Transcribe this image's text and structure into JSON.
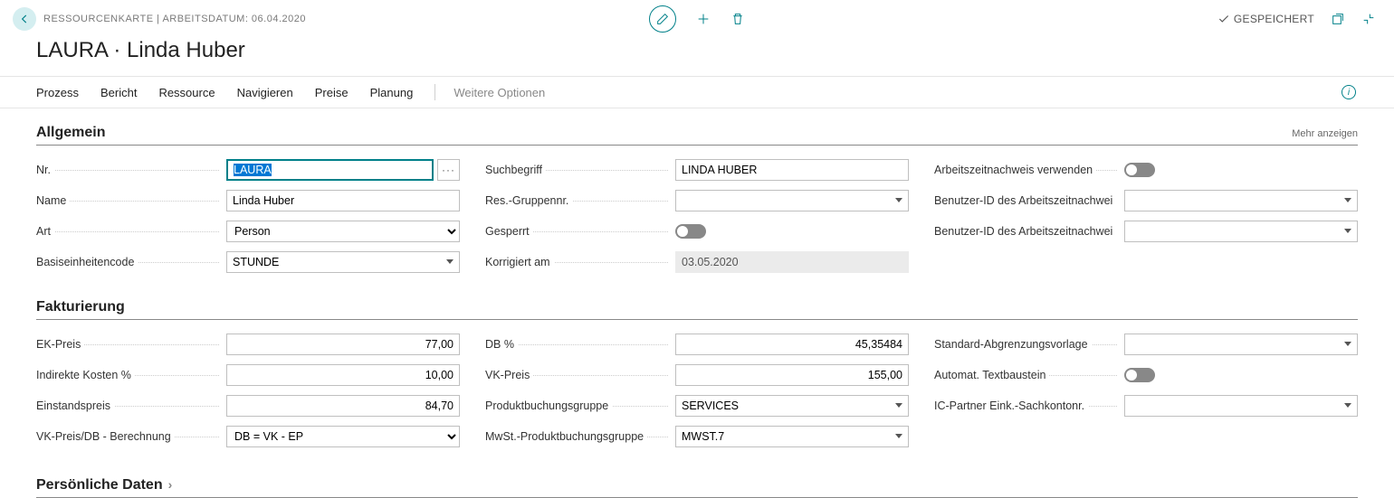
{
  "header": {
    "breadcrumb": "RESSOURCENKARTE | ARBEITSDATUM: 06.04.2020",
    "saved": "GESPEICHERT"
  },
  "title": "LAURA · Linda Huber",
  "menu": {
    "items": [
      "Prozess",
      "Bericht",
      "Ressource",
      "Navigieren",
      "Preise",
      "Planung"
    ],
    "more": "Weitere Optionen"
  },
  "sections": {
    "allgemein": {
      "title": "Allgemein",
      "show_more": "Mehr anzeigen",
      "fields": {
        "nr_label": "Nr.",
        "nr_value": "LAURA",
        "name_label": "Name",
        "name_value": "Linda Huber",
        "art_label": "Art",
        "art_value": "Person",
        "basis_label": "Basiseinheitencode",
        "basis_value": "STUNDE",
        "such_label": "Suchbegriff",
        "such_value": "LINDA HUBER",
        "resgrp_label": "Res.-Gruppennr.",
        "resgrp_value": "",
        "gesperrt_label": "Gesperrt",
        "korr_label": "Korrigiert am",
        "korr_value": "03.05.2020",
        "az_label": "Arbeitszeitnachweis verwenden",
        "benid1_label": "Benutzer-ID des Arbeitszeitnachweis...",
        "benid1_value": "",
        "benid2_label": "Benutzer-ID des Arbeitszeitnachweis...",
        "benid2_value": ""
      }
    },
    "fakturierung": {
      "title": "Fakturierung",
      "fields": {
        "ek_label": "EK-Preis",
        "ek_value": "77,00",
        "indk_label": "Indirekte Kosten %",
        "indk_value": "10,00",
        "einst_label": "Einstandspreis",
        "einst_value": "84,70",
        "vkcalc_label": "VK-Preis/DB - Berechnung",
        "vkcalc_value": "DB = VK - EP",
        "db_label": "DB %",
        "db_value": "45,35484",
        "vk_label": "VK-Preis",
        "vk_value": "155,00",
        "prodbg_label": "Produktbuchungsgruppe",
        "prodbg_value": "SERVICES",
        "mwst_label": "MwSt.-Produktbuchungsgruppe",
        "mwst_value": "MWST.7",
        "stdabgr_label": "Standard-Abgrenzungsvorlage",
        "stdabgr_value": "",
        "autotext_label": "Automat. Textbaustein",
        "icpart_label": "IC-Partner Eink.-Sachkontonr.",
        "icpart_value": ""
      }
    },
    "personal": {
      "title": "Persönliche Daten"
    }
  }
}
